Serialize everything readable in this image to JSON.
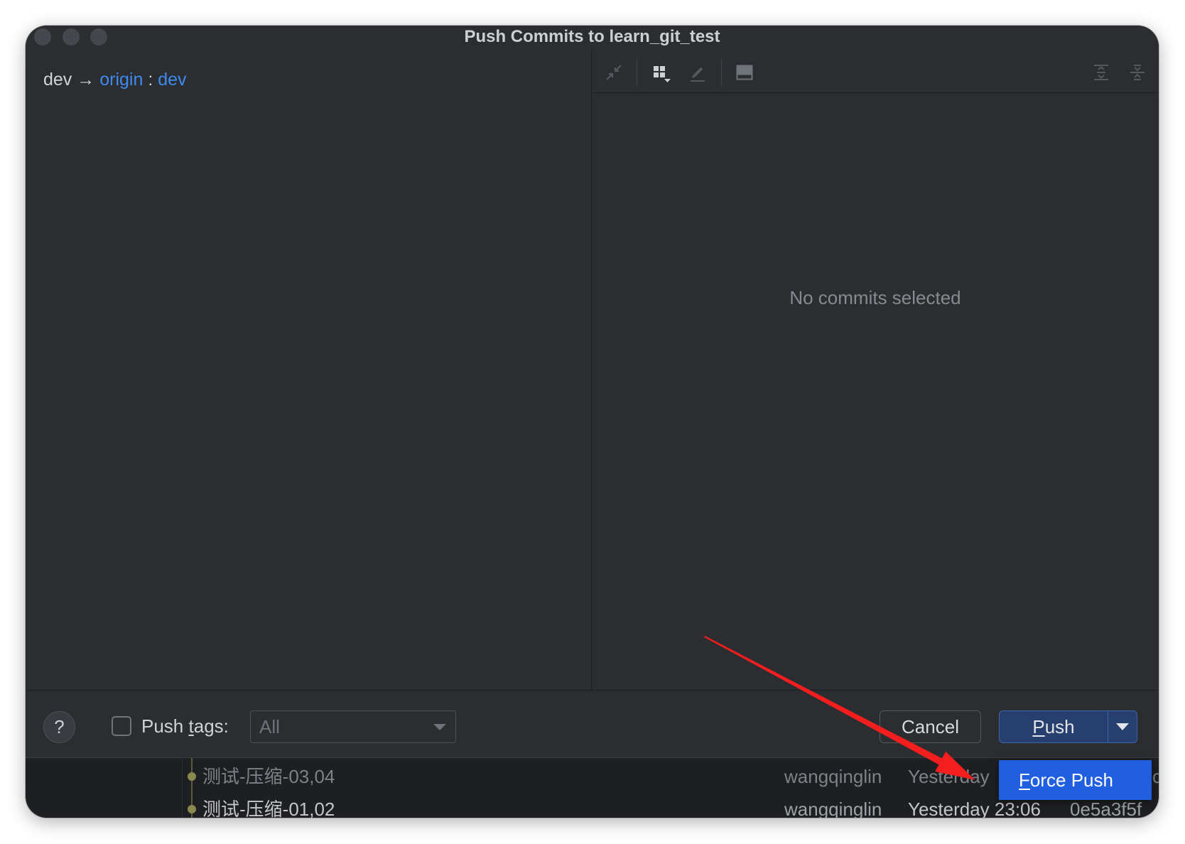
{
  "window": {
    "title": "Push Commits to learn_git_test"
  },
  "branch": {
    "local": "dev",
    "arrow": "→",
    "remote": "origin",
    "separator": ":",
    "remote_branch": "dev"
  },
  "toolbar": {
    "icons": [
      "compress-icon",
      "group-by-icon",
      "edit-icon",
      "preview-panel-icon",
      "expand-all-icon",
      "collapse-all-icon"
    ]
  },
  "details": {
    "empty_text": "No commits selected"
  },
  "footer": {
    "help_label": "?",
    "push_tags_checked": false,
    "push_tags_label": "Push tags:",
    "push_tags_mnemonic": "t",
    "tags_select_value": "All",
    "cancel_label": "Cancel",
    "push_label": "Push",
    "push_mnemonic": "P"
  },
  "push_menu": {
    "items": [
      {
        "label": "Force Push",
        "mnemonic": "F"
      }
    ]
  },
  "log": {
    "rows": [
      {
        "message": "测试-压缩-03,04",
        "author": "wangqinglin",
        "date": "Yesterday",
        "hash": "c"
      },
      {
        "message": "测试-压缩-01,02",
        "author": "wangqinglin",
        "date": "Yesterday 23:06",
        "hash": "0e5a3f5f"
      }
    ]
  },
  "colors": {
    "accent": "#3e8bf0",
    "popup": "#1f5fe0",
    "annotation": "#f51e1e"
  }
}
